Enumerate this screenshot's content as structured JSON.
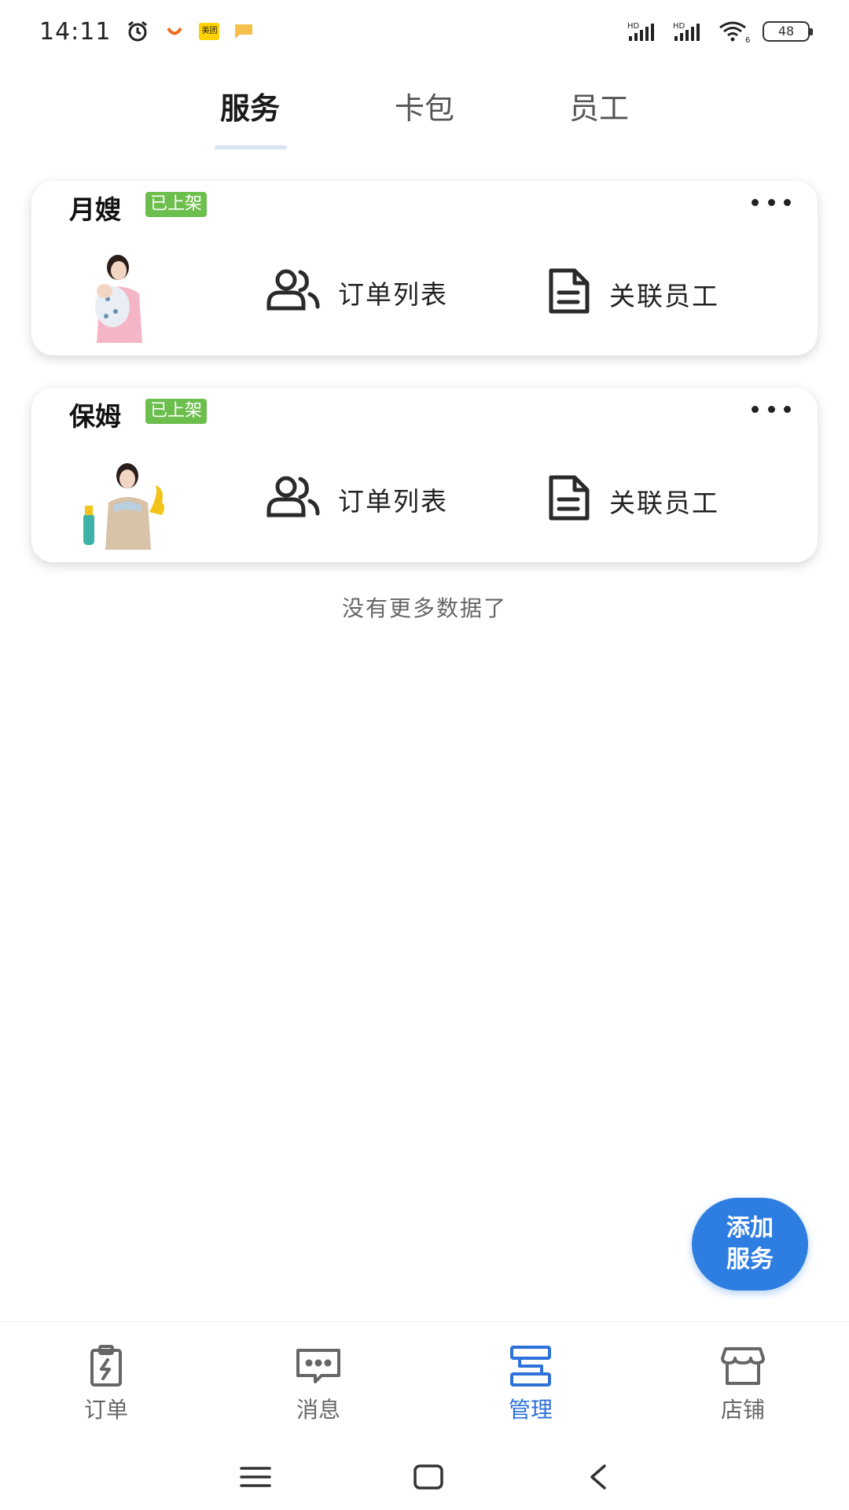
{
  "status_bar": {
    "time": "14:11",
    "app_badge_meituan": "美团",
    "network_1": "HD",
    "network_2": "HD",
    "wifi_label": "6",
    "battery": "48"
  },
  "tabs": [
    {
      "label": "服务",
      "active": true
    },
    {
      "label": "卡包",
      "active": false
    },
    {
      "label": "员工",
      "active": false
    }
  ],
  "services": [
    {
      "title": "月嫂",
      "badge": "已上架",
      "image_icon": "maternity-nurse-photo",
      "actions": [
        {
          "label": "订单列表",
          "icon": "users-icon"
        },
        {
          "label": "关联员工",
          "icon": "document-icon"
        }
      ]
    },
    {
      "title": "保姆",
      "badge": "已上架",
      "image_icon": "nanny-photo",
      "actions": [
        {
          "label": "订单列表",
          "icon": "users-icon"
        },
        {
          "label": "关联员工",
          "icon": "document-icon"
        }
      ]
    }
  ],
  "empty_text": "没有更多数据了",
  "fab": {
    "line1": "添加",
    "line2": "服务"
  },
  "bottom_nav": [
    {
      "label": "订单",
      "icon": "clipboard-icon",
      "active": false
    },
    {
      "label": "消息",
      "icon": "chat-icon",
      "active": false
    },
    {
      "label": "管理",
      "icon": "manage-icon",
      "active": true
    },
    {
      "label": "店铺",
      "icon": "store-icon",
      "active": false
    }
  ],
  "colors": {
    "accent": "#2e7de1",
    "badge_green": "#6cbe4d",
    "nav_active": "#2e72d9"
  }
}
